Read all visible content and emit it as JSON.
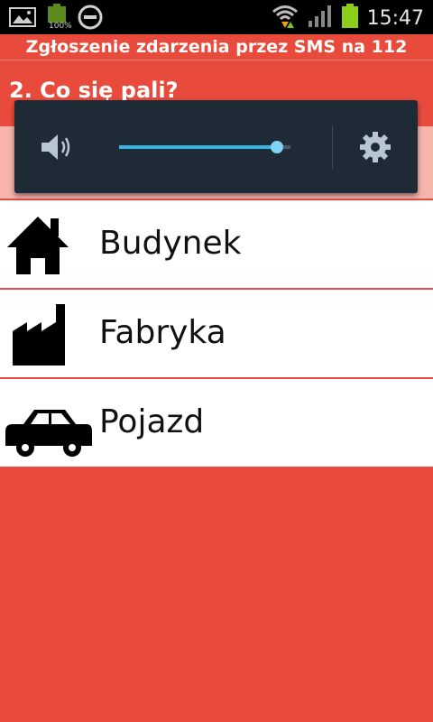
{
  "status_bar": {
    "time": "15:47",
    "battery_percent_label": "100%",
    "icons": [
      "gallery-icon",
      "battery-icon",
      "do-not-disturb-icon",
      "wifi-icon",
      "signal-icon",
      "battery-charging-icon"
    ]
  },
  "app": {
    "title": "Zgłoszenie zdarzenia przez SMS na 112"
  },
  "question": "2. Co się pali?",
  "options": [
    {
      "label": "Budynek",
      "icon": "house-icon"
    },
    {
      "label": "Fabryka",
      "icon": "factory-icon"
    },
    {
      "label": "Pojazd",
      "icon": "car-icon"
    }
  ],
  "volume_panel": {
    "level_fraction": 0.92,
    "accent_color": "#33b5e5",
    "icons": [
      "speaker-icon",
      "settings-gear-icon"
    ]
  },
  "colors": {
    "background": "#e84b3c",
    "list_bg": "#ffffff",
    "panel_bg": "#1f2a37"
  }
}
